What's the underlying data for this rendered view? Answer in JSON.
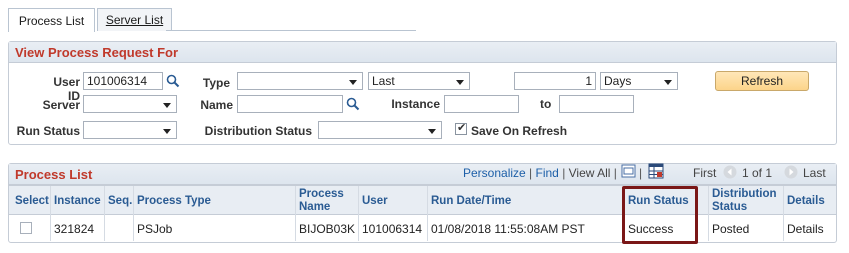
{
  "tabs": [
    {
      "label": "Process List"
    },
    {
      "label": "Server List"
    }
  ],
  "request_panel": {
    "title": "View Process Request For",
    "user_id_label": "User ID",
    "user_id_value": "101006314",
    "type_label": "Type",
    "type_value": "",
    "last_value": "Last",
    "last_number": "1",
    "days_value": "Days",
    "refresh_label": "Refresh",
    "server_label": "Server",
    "server_value": "",
    "name_label": "Name",
    "name_value": "",
    "instance_label": "Instance",
    "instance_from": "",
    "to_label": "to",
    "instance_to": "",
    "run_status_label": "Run Status",
    "run_status_value": "",
    "dist_status_label": "Distribution Status",
    "dist_status_value": "",
    "save_on_refresh_label": "Save On Refresh",
    "save_on_refresh_checked": true
  },
  "process_list": {
    "title": "Process List",
    "personalize": "Personalize",
    "find": "Find",
    "view_all": "View All",
    "first": "First",
    "range": "1 of 1",
    "last": "Last",
    "headers": {
      "select": "Select",
      "instance": "Instance",
      "seq": "Seq.",
      "process_type": "Process Type",
      "process_name_1": "Process",
      "process_name_2": "Name",
      "user": "User",
      "run_datetime": "Run Date/Time",
      "run_status": "Run Status",
      "dist_status_1": "Distribution",
      "dist_status_2": "Status",
      "details": "Details"
    },
    "rows": [
      {
        "instance": "321824",
        "seq": "",
        "process_type": "PSJob",
        "process_name": "BIJOB03K",
        "user": "101006314",
        "run_datetime": "01/08/2018 11:55:08AM PST",
        "run_status": "Success",
        "dist_status": "Posted",
        "details": "Details"
      }
    ]
  },
  "colors": {
    "header_red": "#c0392b",
    "link_blue": "#1d5fa8",
    "highlight_box": "#7a1717"
  }
}
